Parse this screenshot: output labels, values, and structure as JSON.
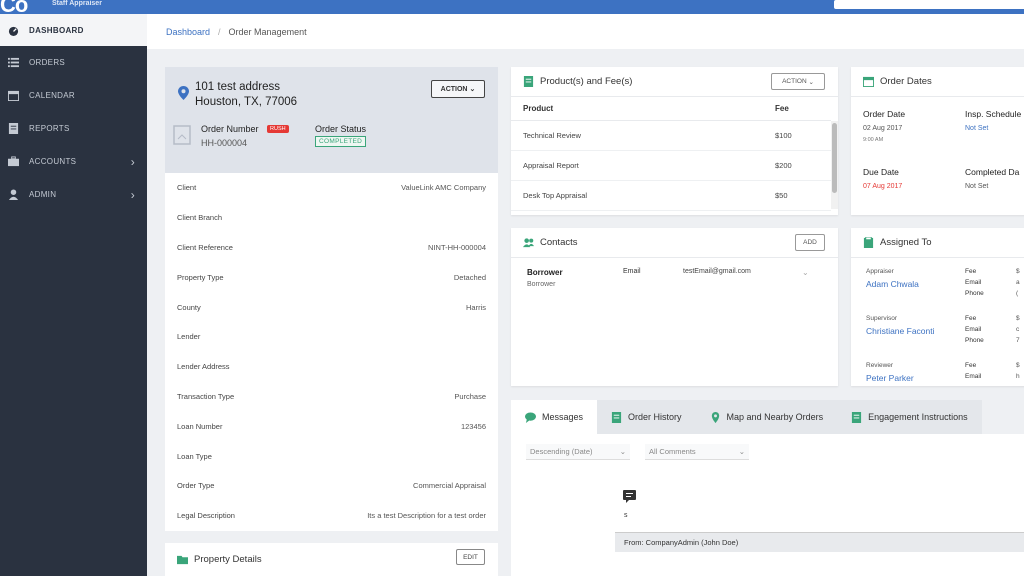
{
  "header": {
    "logo": "Co",
    "subtitle": "Staff Appraiser"
  },
  "sidebar": {
    "items": [
      {
        "label": "DASHBOARD",
        "icon": "dashboard-icon",
        "active": true
      },
      {
        "label": "ORDERS",
        "icon": "list-icon"
      },
      {
        "label": "CALENDAR",
        "icon": "calendar-icon"
      },
      {
        "label": "REPORTS",
        "icon": "reports-icon"
      },
      {
        "label": "ACCOUNTS",
        "icon": "accounts-icon",
        "chevron": "›"
      },
      {
        "label": "ADMIN",
        "icon": "user-icon",
        "chevron": "›"
      }
    ]
  },
  "breadcrumb": {
    "home": "Dashboard",
    "sep": "/",
    "current": "Order Management"
  },
  "order": {
    "address_line1": "101 test address",
    "address_line2": "Houston, TX, 77006",
    "action_label": "ACTION",
    "number_label": "Order Number",
    "rush_label": "RUSH",
    "number": "HH-000004",
    "status_label": "Order Status",
    "status": "COMPLETED",
    "details": [
      {
        "label": "Client",
        "value": "ValueLink AMC Company"
      },
      {
        "label": "Client Branch",
        "value": ""
      },
      {
        "label": "Client Reference",
        "value": "NINT-HH-000004"
      },
      {
        "label": "Property Type",
        "value": "Detached"
      },
      {
        "label": "County",
        "value": "Harris"
      },
      {
        "label": "Lender",
        "value": ""
      },
      {
        "label": "Lender Address",
        "value": ""
      },
      {
        "label": "Transaction Type",
        "value": "Purchase"
      },
      {
        "label": "Loan Number",
        "value": "123456"
      },
      {
        "label": "Loan Type",
        "value": ""
      },
      {
        "label": "Order Type",
        "value": "Commercial Appraisal"
      },
      {
        "label": "Legal Description",
        "value": "Its a test Description for a test order"
      }
    ]
  },
  "property": {
    "title": "Property Details",
    "edit_label": "EDIT"
  },
  "products": {
    "title": "Product(s) and Fee(s)",
    "action_label": "ACTION",
    "col_product": "Product",
    "col_fee": "Fee",
    "rows": [
      {
        "product": "Technical Review",
        "fee": "$100"
      },
      {
        "product": "Appraisal Report",
        "fee": "$200"
      },
      {
        "product": "Desk Top Appraisal",
        "fee": "$50"
      }
    ]
  },
  "dates": {
    "title": "Order Dates",
    "order_date_label": "Order Date",
    "order_date": "02 Aug 2017",
    "order_time": "9:00 AM",
    "insp_label": "Insp. Schedule",
    "insp_value": "Not Set",
    "due_label": "Due Date",
    "due_value": "07 Aug 2017",
    "completed_label": "Completed Da",
    "completed_value": "Not Set"
  },
  "contacts": {
    "title": "Contacts",
    "add_label": "ADD",
    "name": "Borrower",
    "role": "Borrower",
    "email_label": "Email",
    "email": "testEmail@gmail.com"
  },
  "assigned": {
    "title": "Assigned To",
    "people": [
      {
        "role": "Appraiser",
        "name": "Adam Chwala",
        "keys": [
          "Fee",
          "Email",
          "Phone"
        ],
        "vals": [
          "$",
          "a",
          "("
        ]
      },
      {
        "role": "Supervisor",
        "name": "Christiane Faconti",
        "keys": [
          "Fee",
          "Email",
          "Phone"
        ],
        "vals": [
          "$",
          "c",
          "7"
        ]
      },
      {
        "role": "Reviewer",
        "name": "Peter Parker",
        "keys": [
          "Fee",
          "Email"
        ],
        "vals": [
          "$",
          "h"
        ]
      }
    ]
  },
  "tabs": [
    {
      "label": "Messages",
      "icon": "chat-icon",
      "active": true
    },
    {
      "label": "Order History",
      "icon": "document-icon"
    },
    {
      "label": "Map and Nearby Orders",
      "icon": "pin-icon"
    },
    {
      "label": "Engagement Instructions",
      "icon": "document-icon"
    }
  ],
  "messages": {
    "sort_value": "Descending (Date)",
    "filter_value": "All Comments",
    "text": "s",
    "from": "From: CompanyAdmin (John Doe)"
  },
  "colors": {
    "topbar": "#3d72c2",
    "sidebar": "#2a3240",
    "link": "#3d72c2",
    "rush": "#e53935",
    "completed": "#3aa57a",
    "due": "#e53935",
    "icon_green": "#3aa57a"
  }
}
